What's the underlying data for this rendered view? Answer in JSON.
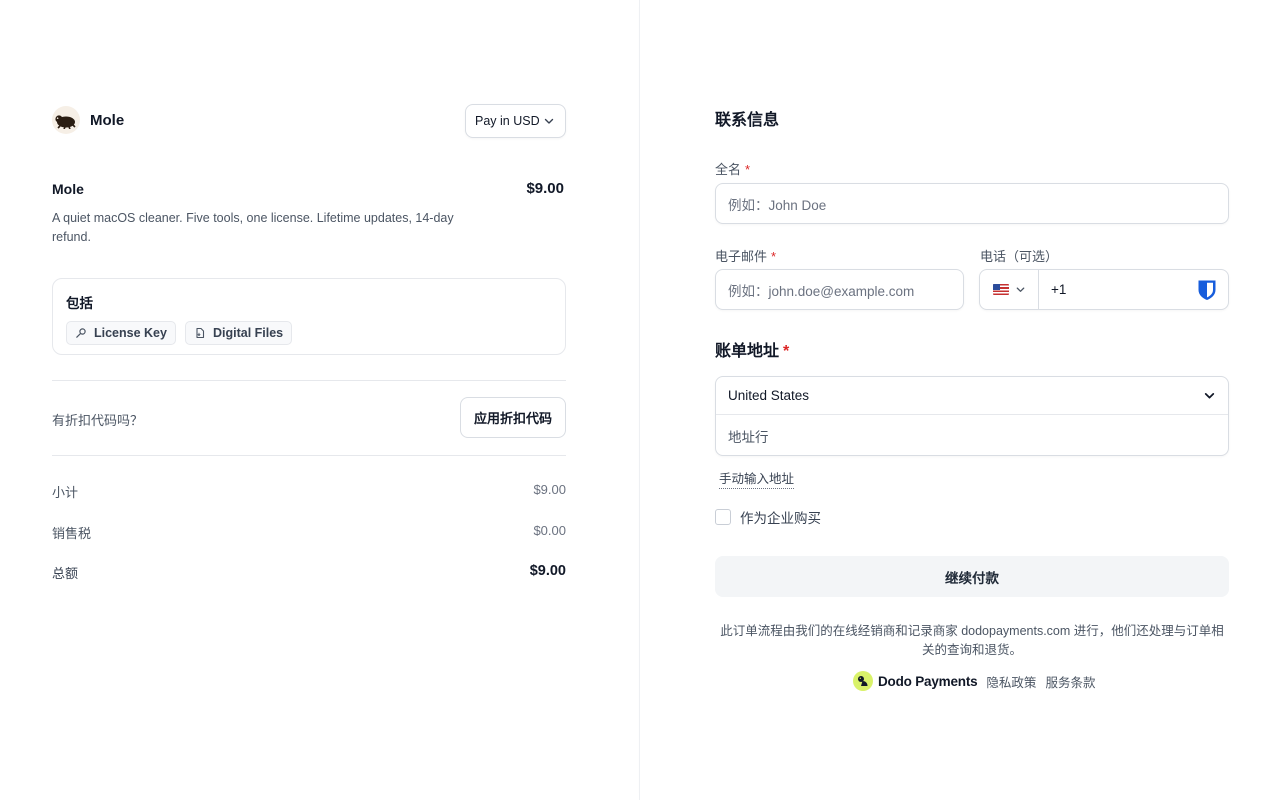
{
  "brand": {
    "name": "Mole"
  },
  "currency": {
    "label": "Pay in USD"
  },
  "product": {
    "title": "Mole",
    "price": "$9.00",
    "description": "A quiet macOS cleaner. Five tools, one license. Lifetime updates, 14-day refund."
  },
  "includes": {
    "title": "包括",
    "items": [
      {
        "label": "License Key",
        "icon": "key-icon"
      },
      {
        "label": "Digital Files",
        "icon": "file-icon"
      }
    ]
  },
  "discount": {
    "question": "有折扣代码吗？",
    "apply_label": "应用折扣代码"
  },
  "summary": {
    "subtotal_label": "小计",
    "subtotal": "$9.00",
    "tax_label": "销售税",
    "tax": "$0.00",
    "total_label": "总额",
    "total": "$9.00"
  },
  "contact": {
    "title": "联系信息",
    "full_name_label": "全名",
    "full_name_placeholder": "例如：John Doe",
    "email_label": "电子邮件",
    "email_placeholder": "例如：john.doe@example.com",
    "phone_label": "电话（可选）",
    "phone_code": "+1",
    "required_mark": "*"
  },
  "billing": {
    "title": "账单地址",
    "country": "United States",
    "address_placeholder": "地址行",
    "manual_link": "手动输入地址",
    "business_label": "作为企业购买"
  },
  "actions": {
    "continue_label": "继续付款"
  },
  "footer": {
    "disclaimer": "此订单流程由我们的在线经销商和记录商家 dodopayments.com 进行，他们还处理与订单相关的查询和退货。",
    "provider": "Dodo Payments",
    "privacy": "隐私政策",
    "terms": "服务条款"
  },
  "colors": {
    "required": "#dc2626",
    "continue_bg": "#f3f5f7",
    "dodo_logo": "#d9f26a",
    "password_manager": "#175ddc"
  }
}
